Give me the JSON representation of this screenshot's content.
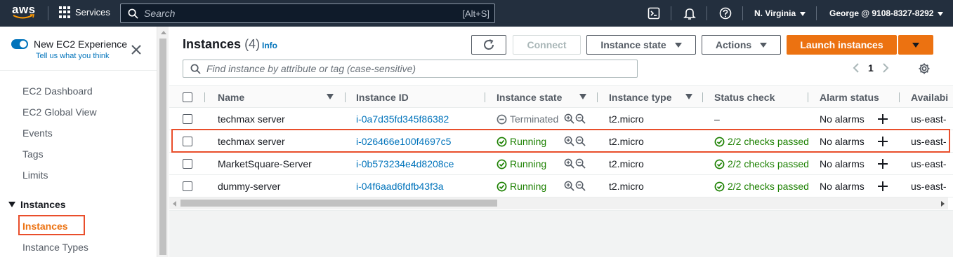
{
  "topnav": {
    "logo": "aws",
    "services_label": "Services",
    "search_placeholder": "Search",
    "search_shortcut": "[Alt+S]",
    "region": "N. Virginia",
    "account": "George @ 9108-8327-8292"
  },
  "sidebar": {
    "new_experience": "New EC2 Experience",
    "tell_us": "Tell us what you think",
    "items": [
      "EC2 Dashboard",
      "EC2 Global View",
      "Events",
      "Tags",
      "Limits"
    ],
    "section": "Instances",
    "active_item": "Instances",
    "after_active": "Instance Types"
  },
  "main": {
    "title": "Instances",
    "count": "(4)",
    "info": "Info",
    "connect": "Connect",
    "instance_state": "Instance state",
    "actions": "Actions",
    "launch": "Launch instances",
    "filter_placeholder": "Find instance by attribute or tag (case-sensitive)",
    "page": "1"
  },
  "table": {
    "headers": [
      "Name",
      "Instance ID",
      "Instance state",
      "Instance type",
      "Status check",
      "Alarm status",
      "Availabi"
    ],
    "rows": [
      {
        "name": "techmax server",
        "id": "i-0a7d35fd345f86382",
        "state": "Terminated",
        "type": "t2.micro",
        "check": "–",
        "alarm": "No alarms",
        "az": "us-east-"
      },
      {
        "name": "techmax server",
        "id": "i-026466e100f4697c5",
        "state": "Running",
        "type": "t2.micro",
        "check": "2/2 checks passed",
        "alarm": "No alarms",
        "az": "us-east-"
      },
      {
        "name": "MarketSquare-Server",
        "id": "i-0b573234e4d8208ce",
        "state": "Running",
        "type": "t2.micro",
        "check": "2/2 checks passed",
        "alarm": "No alarms",
        "az": "us-east-"
      },
      {
        "name": "dummy-server",
        "id": "i-04f6aad6fdfb43f3a",
        "state": "Running",
        "type": "t2.micro",
        "check": "2/2 checks passed",
        "alarm": "No alarms",
        "az": "us-east-"
      }
    ]
  },
  "colors": {
    "nav_bg": "#232f3e",
    "primary": "#ec7211",
    "link": "#0073bb",
    "success": "#1d8102",
    "highlight": "#e94e2b"
  }
}
